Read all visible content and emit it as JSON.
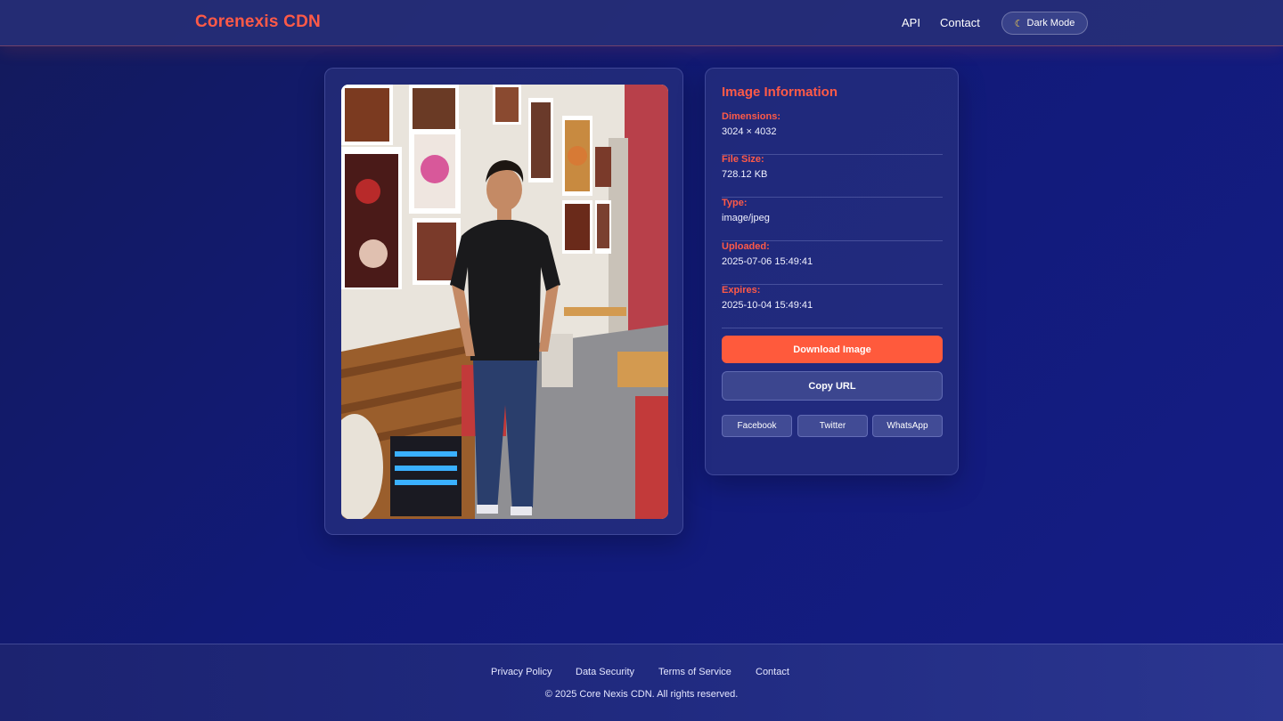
{
  "header": {
    "brand": "Corenexis CDN",
    "nav": [
      "API",
      "Contact"
    ],
    "dark_mode_label": "Dark Mode",
    "dark_mode_icon": "moon-icon"
  },
  "image_info": {
    "title": "Image Information",
    "fields": [
      {
        "label": "Dimensions:",
        "value": "3024 × 4032"
      },
      {
        "label": "File Size:",
        "value": "728.12 KB"
      },
      {
        "label": "Type:",
        "value": "image/jpeg"
      },
      {
        "label": "Uploaded:",
        "value": "2025-07-06 15:49:41"
      },
      {
        "label": "Expires:",
        "value": "2025-10-04 15:49:41"
      }
    ],
    "download_label": "Download Image",
    "copy_label": "Copy URL",
    "share": [
      "Facebook",
      "Twitter",
      "WhatsApp"
    ]
  },
  "footer": {
    "links": [
      "Privacy Policy",
      "Data Security",
      "Terms of Service",
      "Contact"
    ],
    "copyright": "© 2025 Core Nexis CDN. All rights reserved."
  },
  "colors": {
    "accent": "#ff5a47",
    "button": "#ff5a3c"
  }
}
